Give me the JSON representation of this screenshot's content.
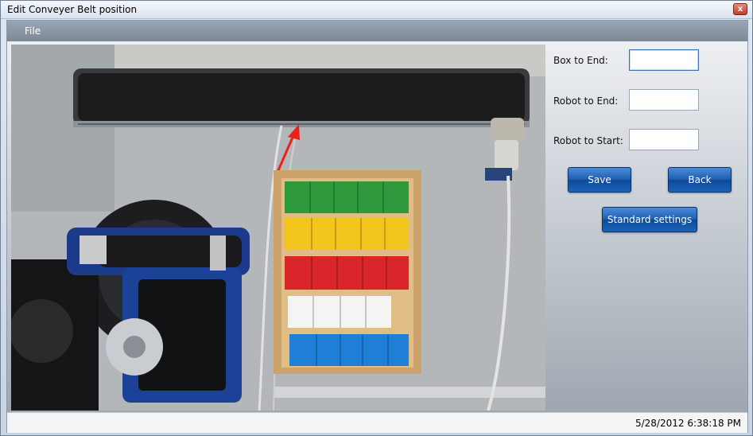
{
  "window": {
    "title": "Edit Conveyer Belt position",
    "close_glyph": "x"
  },
  "menu": {
    "file": "File"
  },
  "form": {
    "box_to_end_label": "Box to End:",
    "box_to_end_value": "",
    "robot_to_end_label": "Robot to End:",
    "robot_to_end_value": "",
    "robot_to_start_label": "Robot to Start:",
    "robot_to_start_value": ""
  },
  "buttons": {
    "save": "Save",
    "back": "Back",
    "standard_settings": "Standard settings"
  },
  "status": {
    "datetime": "5/28/2012 6:38:18 PM"
  },
  "colors": {
    "button_blue": "#1f5fae",
    "arrow_red": "#e8241a",
    "block_green": "#2e9a3c",
    "block_yellow": "#f2c51c",
    "block_red": "#d8262a",
    "block_white": "#f4f4f2",
    "block_blue": "#1f7fd6"
  }
}
